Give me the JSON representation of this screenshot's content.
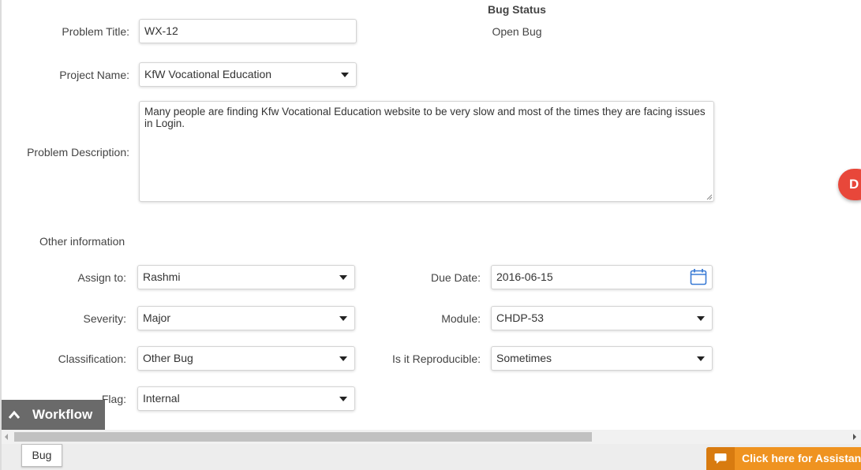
{
  "form": {
    "problem_title_label": "Problem Title:",
    "problem_title_value": "WX-12",
    "project_name_label": "Project Name:",
    "project_name_value": "KfW Vocational Education",
    "problem_description_label": "Problem Description:",
    "problem_description_value": "Many people are finding Kfw Vocational Education website to be very slow and most of the times they are facing issues in Login."
  },
  "bug_status": {
    "title": "Bug Status",
    "value": "Open Bug"
  },
  "other_info": {
    "section_title": "Other information",
    "assign_to_label": "Assign to:",
    "assign_to_value": "Rashmi",
    "due_date_label": "Due Date:",
    "due_date_value": "2016-06-15",
    "severity_label": "Severity:",
    "severity_value": "Major",
    "module_label": "Module:",
    "module_value": "CHDP-53",
    "classification_label": "Classification:",
    "classification_value": "Other Bug",
    "reproducible_label": "Is it Reproducible:",
    "reproducible_value": "Sometimes",
    "flag_label": "Flag:",
    "flag_value": "Internal"
  },
  "floating_button": {
    "label": "D"
  },
  "workflow": {
    "label": "Workflow"
  },
  "tabs": {
    "bug_tab": "Bug"
  },
  "assistance": {
    "label": "Click here for Assistance"
  },
  "colors": {
    "fab_red": "#e8473a",
    "workflow_gray": "#6a6a6a",
    "assist_orange": "#ef9320",
    "calendar_blue": "#3a7bd5"
  },
  "icons": {
    "dropdown": "caret-down-icon",
    "calendar": "calendar-icon",
    "workflow_toggle": "chevron-up-icon",
    "assistance": "chat-bubble-icon"
  }
}
